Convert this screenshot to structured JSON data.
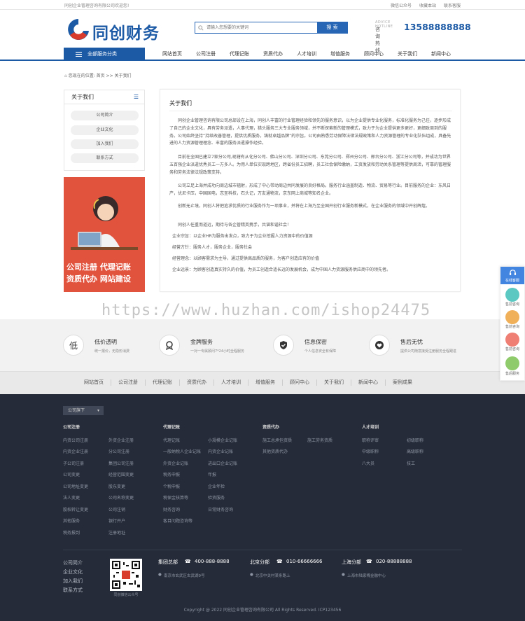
{
  "topbar": {
    "welcome": "同创企业管理咨询有限公司欢迎您!",
    "links": [
      "微信公众号",
      "收藏本站",
      "联系客服"
    ]
  },
  "header": {
    "logo_text": "同创财务",
    "search_placeholder": "请输入您想要的关键词",
    "search_button": "搜 索",
    "hotline_en": "ADVICE HOTLINE",
    "hotline_label": "咨询热线",
    "hotline_number": "13588888888"
  },
  "nav": {
    "category_button": "全部服务分类",
    "items": [
      "网站首页",
      "公司注册",
      "代理记账",
      "资质代办",
      "人才培训",
      "增值服务",
      "顾问中心",
      "关于我们",
      "新闻中心"
    ]
  },
  "breadcrumb": "您现在的位置: 首页 >> 关于我们",
  "sidebar": {
    "title": "关于我们",
    "items": [
      "公司简介",
      "企业文化",
      "加入我们",
      "联系方式"
    ]
  },
  "banner": {
    "line1": "公司注册  代理记账",
    "line2": "资质代办  网站建设"
  },
  "content": {
    "title": "关于我们",
    "paragraphs": [
      "同创企业管理咨询有限公司总部设在上海，同创人丰富的行业管理经验和领先的服务意识，以为企业提供专业化服务，标准化服务为己任，逐步形成了自己的企业文化，具有劳务派遣，人事代理，猎头服务三大专业服务领域，并不断探索新的管理模式，致力于为企业提供更多更好，更细致周到的服务。公司始终坚持“持续改善管理，提供优质服务，铸就卓越品牌”的宗旨。公司由熟悉劳动保障法律法规政策和人力资源管理的专业化队伍组成，具备先进的人力资源管理理念、丰富的服务派遣操作经验。",
      "目前在全国已建立7家分公司,现辖有从化分公司、佛山分公司、深圳分公司、东莞分公司、郑州分公司、邢台分公司、浙江分公司等，并成功为世界五百强企业派遣优秀员工一万多人。为用人单位实现跨地区，跨省份员工招聘，员工社会保险缴纳，工资发放和劳动关系管理等提供周活，可靠的管理服务和劳务法律法规政策支持。",
      "公司立足上海并成功向周边城市辐射，形成了中心带动周边共同发展的良好格局。服务行业涵盖制造、物流、贸易等行业。目前服务的企业：东风日产，优尼卡压，中国国电，志圣科技，石头记，万友通物流，京东网上商城等知名企业。",
      "创新无止境，同创人将把追求优质的行业服务作为一项事业，并将在上海乃至全国开创行业服务新模式，在企业服务的领域中开创辉煌。",
      "同创人任重而道远，期待与各企管精英携手，共谱和谐社会！",
      "企业宗旨：以企业HR为服务出发点，致力于为企业挖掘人力资源中的价值源",
      "经营方针：服务人才，服务企业，服务社会",
      "经营理念：以顾客需求为主导，通过提供高品质的服务，为客户创造应有的价值",
      "企业远景：为顾客创造真实持久的价值，为员工创造合适长远的发展机会，成为中国人力资源服务供应商中的领先者。"
    ]
  },
  "watermark": "https://www.huzhan.com/ishop24475",
  "float_panel": {
    "header": "在线客服",
    "items": [
      "售前咨询",
      "售前咨询",
      "售前咨询",
      "售后服务"
    ]
  },
  "features": [
    {
      "icon": "低",
      "title": "低价透明",
      "desc": "统一报价，无隐形消费"
    },
    {
      "icon": "medal-icon",
      "title": "金牌服务",
      "desc": "一对一专属顾问7*24小时全程服务"
    },
    {
      "icon": "shield-icon",
      "title": "信息保密",
      "desc": "个人信息安全有保障"
    },
    {
      "icon": "heart-icon",
      "title": "售后无忧",
      "desc": "提供公司随意接受注册服务全程跟进"
    }
  ],
  "footer_nav": [
    "网站首页",
    "公司注册",
    "代理记账",
    "资质代办",
    "人才培训",
    "增值服务",
    "顾问中心",
    "关于我们",
    "新闻中心",
    "案例成果"
  ],
  "footer": {
    "dropdown": "公司旗下",
    "columns": [
      {
        "title": "公司注册",
        "links": [
          "内资公司注册",
          "外资企业注册",
          "内资企业注册",
          "分公司注册",
          "子公司注册",
          "集团公司注册",
          "公司变更",
          "经营范围变更",
          "公司地址变更",
          "股东变更",
          "法人变更",
          "公司名称变更",
          "股权转让变更",
          "公司注销",
          "其他服务",
          "银行开户",
          "税务报到",
          "注册地址"
        ]
      },
      {
        "title": "代理记账",
        "links": [
          "代理记账",
          "小规模企业记账",
          "一般纳税人企业记账",
          "内资企业记账",
          "外资企业记账",
          "进出口企业记账",
          "税务申报",
          "年报",
          "个税申报",
          "企业年检",
          "税保金核算等",
          "验资服务",
          "财务咨询",
          "日常财务咨询",
          "客目问题咨询等"
        ]
      },
      {
        "title": "资质代办",
        "links": [
          "施工总承包资质",
          "施工劳务资质",
          "其他资质代办"
        ]
      },
      {
        "title": "人才培训",
        "links": [
          "职称评审",
          "初级职称",
          "中级职称",
          "高级职称",
          "八大员",
          "技工"
        ]
      }
    ],
    "bottom_links": [
      "公司简介",
      "企业文化",
      "加入我们",
      "联系方式"
    ],
    "qr_caption": "同创微信公众号",
    "offices": [
      {
        "city": "集团总部",
        "phone": "400-888-8888",
        "address": "南京市玄武区玄武湖9号"
      },
      {
        "city": "北京分部",
        "phone": "010-66666666",
        "address": "北京中关村某条路上"
      },
      {
        "city": "上海分部",
        "phone": "020-88888888",
        "address": "上海市陆家嘴金融中心"
      }
    ],
    "copyright": "Copyright @ 2022 同创企业管理咨询有限公司 All Rights Reserved.   ICP123456"
  }
}
